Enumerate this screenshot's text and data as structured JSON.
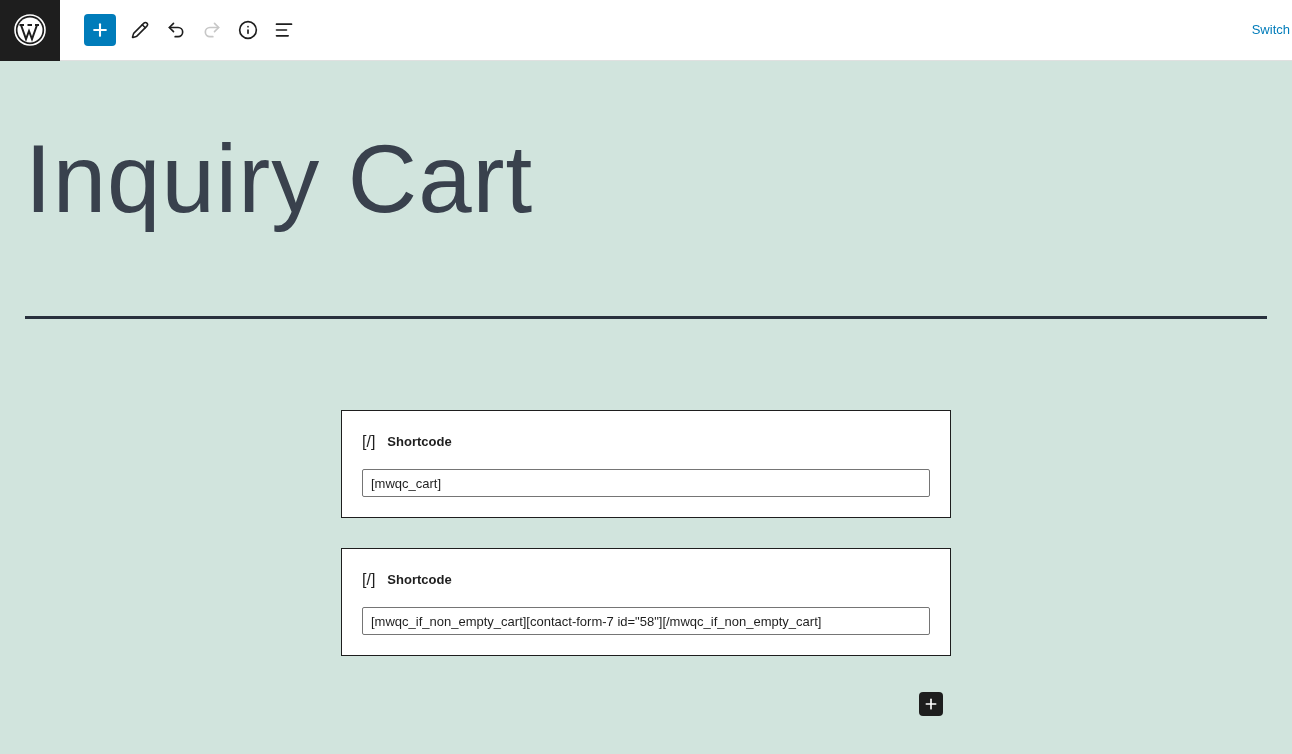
{
  "toolbar": {
    "tools": [
      {
        "kind": "add",
        "disabled": false
      },
      {
        "kind": "edit",
        "disabled": false
      },
      {
        "kind": "undo",
        "disabled": false
      },
      {
        "kind": "redo",
        "disabled": true
      },
      {
        "kind": "info",
        "disabled": false
      },
      {
        "kind": "outline",
        "disabled": false
      }
    ],
    "switch_link": "Switch"
  },
  "page": {
    "title": "Inquiry Cart",
    "blocks": [
      {
        "icon": "[/]",
        "label": "Shortcode",
        "value": "[mwqc_cart]"
      },
      {
        "icon": "[/]",
        "label": "Shortcode",
        "value": "[mwqc_if_non_empty_cart][contact-form-7 id=\"58\"][/mwqc_if_non_empty_cart]"
      }
    ]
  }
}
